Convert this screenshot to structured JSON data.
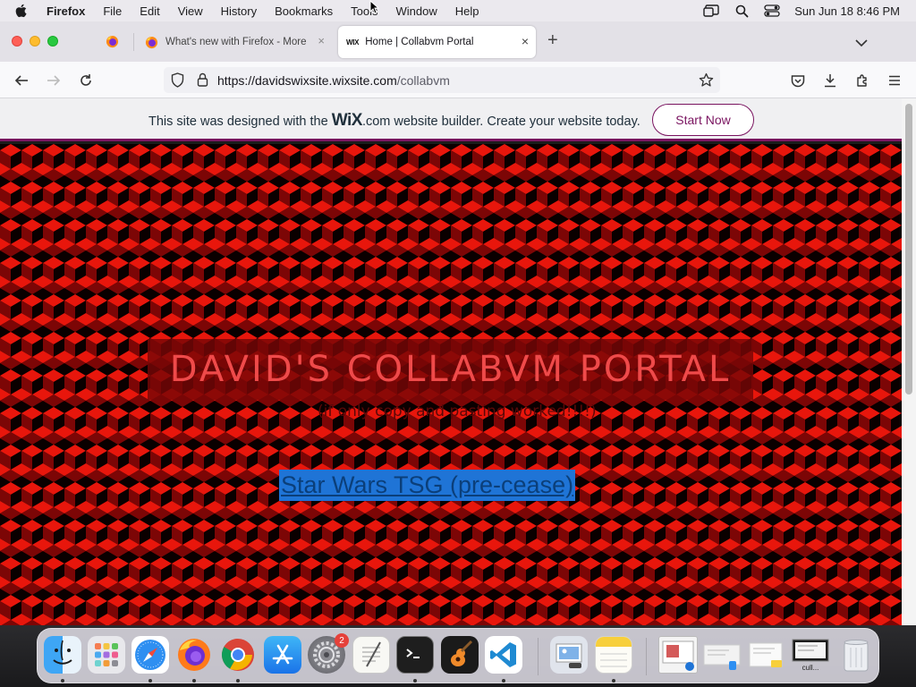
{
  "menubar": {
    "app_name": "Firefox",
    "items": [
      "File",
      "Edit",
      "View",
      "History",
      "Bookmarks",
      "Tools",
      "Window",
      "Help"
    ],
    "clock": "Sun Jun 18  8:46 PM"
  },
  "tabs": [
    {
      "title": "What's new with Firefox - More"
    },
    {
      "favicon_text": "WIX",
      "title": "Home | Collabvm Portal",
      "close": "×"
    }
  ],
  "new_tab_label": "+",
  "url": {
    "host": "https://davidswixsite.wixsite.com",
    "path": "/collabvm"
  },
  "wix_banner": {
    "message_before": "This site was designed with the ",
    "logo": "WiX",
    "message_after": ".com website builder. Create your website today.",
    "button_label": "Start Now",
    "accent_color": "#7a1460"
  },
  "page": {
    "title": "DAVID'S COLLABVM PORTAL",
    "subtitle": "(if only copy and pasting worked!!!!)",
    "link_text": "Star Wars TSG (pre-cease)",
    "background_colors": [
      "#e8160c",
      "#7c0606",
      "#0a0000"
    ]
  },
  "dock": {
    "items": [
      {
        "name": "finder-icon",
        "running": true
      },
      {
        "name": "launchpad-icon",
        "running": false
      },
      {
        "name": "safari-icon",
        "running": true
      },
      {
        "name": "firefox-icon",
        "running": true
      },
      {
        "name": "chrome-icon",
        "running": true
      },
      {
        "name": "app-store-icon",
        "running": false
      },
      {
        "name": "system-settings-icon",
        "running": false,
        "badge": "2"
      },
      {
        "name": "textedit-icon",
        "running": false
      },
      {
        "name": "terminal-icon",
        "running": true
      },
      {
        "name": "garageband-icon",
        "running": false
      },
      {
        "name": "vscode-icon",
        "running": true
      },
      {
        "name": "preview-icon",
        "running": false
      },
      {
        "name": "notes-icon",
        "running": true
      }
    ],
    "minimized_label": "cull..."
  }
}
